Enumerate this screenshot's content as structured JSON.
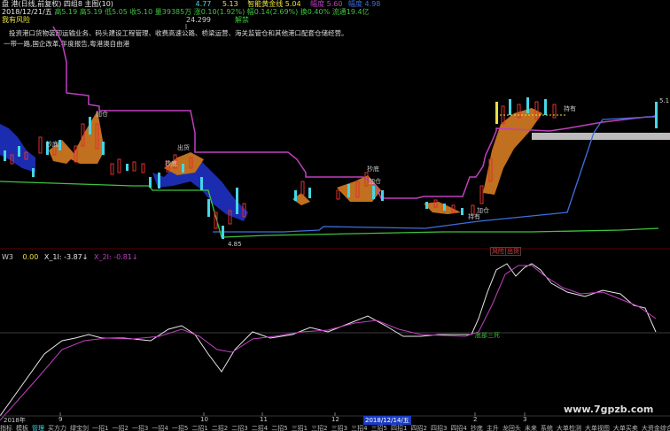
{
  "header": {
    "line1": {
      "title": "盘 港(日线,前复权) 四组8 主图(10)",
      "open_label": "5.1",
      "high": "4.77",
      "b2": "5.13",
      "gold_label": "智能黄金线 5.04",
      "amp_label": "幅度 5.60",
      "low_label": "幅度 4.98"
    },
    "line2": {
      "date": "2018/12/21/五",
      "vals": "高5.19 高5.19 低5.05 收5.10 量39385万 涨0.10(1.92%) 幅0.14(2.69%) 换0.40% 流通19.4亿"
    },
    "line3_left": "我有风险",
    "line3_mid": "24.299",
    "line3_right": "解禁"
  },
  "news": {
    "line1": "投资港口货物装卸运输业务、码头建设工程管理、收费高速公路、桥梁运营、海关监管仓和其他港口配套仓储经营。",
    "line2": "一带一路,国企改革,年度报告,粤港澳自由港"
  },
  "annotations": {
    "top_price": "5.1",
    "low_price": "4.85",
    "labels": [
      "抄底",
      "加仓",
      "出货",
      "抄底",
      "抄底",
      "加仓",
      "加仓",
      "持有",
      "出货",
      "加仓",
      "风险",
      "持有"
    ],
    "right_values": [
      "5.1",
      "24.299"
    ]
  },
  "indicator": {
    "name": "W3",
    "v0": "0.00",
    "x1": "X_1I: -3.87↓",
    "x2": "X_2I: -0.81↓",
    "label_below": "底部三死",
    "date_highlight": "2018/12/14/五"
  },
  "xaxis": {
    "labels": [
      "2018年",
      "9",
      "10",
      "11",
      "12",
      "2",
      "3"
    ]
  },
  "tabs": [
    "指标",
    "模板",
    "管理",
    "买方力",
    "绿宝剑",
    "一招1",
    "一招2",
    "一招3",
    "一招4",
    "一招5",
    "二招1",
    "二招2",
    "二招3",
    "二招4",
    "二招5",
    "三招1",
    "三招2",
    "三招3",
    "三招4",
    "三招5",
    "四招1",
    "四招2",
    "四招3",
    "四招4",
    "抄底",
    "主升",
    "龙回头",
    "未来",
    "系统",
    "大单检测",
    "大单视图",
    "大单买卖",
    "大资金综合",
    "底部三死",
    "量化"
  ],
  "watermark": "www.7gpzb.com",
  "colors": {
    "magenta": "#c040c0",
    "blue": "#3e6fe0",
    "green": "#3ec43e",
    "cyan": "#46d6e6",
    "orange": "#c0701e",
    "navy": "#1c2cb0",
    "red": "#e03030",
    "yellow": "#e8e040"
  }
}
